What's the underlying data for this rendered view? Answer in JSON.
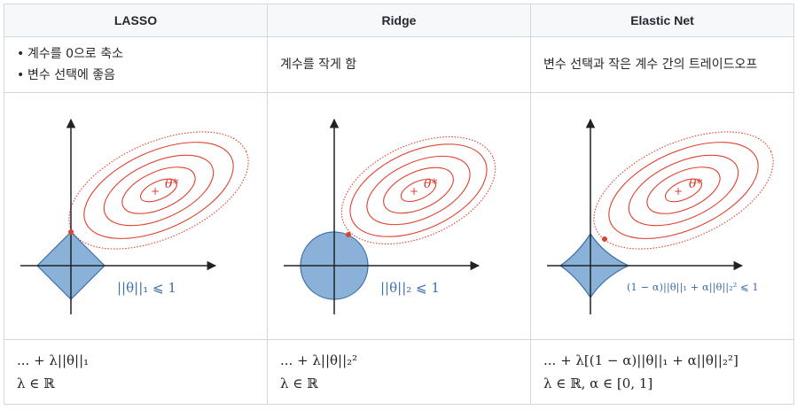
{
  "columns": [
    {
      "title": "LASSO",
      "description_bullets": [
        "계수를 0으로 축소",
        "변수 선택에 좋음"
      ],
      "plot": {
        "shape": "diamond",
        "theta_label": "θ*",
        "constraint_label": "||θ||₁ ⩽ 1"
      },
      "formula_line1": "... + λ||θ||₁",
      "formula_line2": "λ ∈ ℝ"
    },
    {
      "title": "Ridge",
      "description_text": "계수를 작게 함",
      "plot": {
        "shape": "circle",
        "theta_label": "θ*",
        "constraint_label": "||θ||₂ ⩽ 1"
      },
      "formula_line1": "... + λ||θ||₂²",
      "formula_line2": "λ ∈ ℝ"
    },
    {
      "title": "Elastic Net",
      "description_text": "변수 선택과 작은 계수 간의 트레이드오프",
      "plot": {
        "shape": "rounded-diamond",
        "theta_label": "θ*",
        "constraint_label": "(1 − α)||θ||₁ + α||θ||₂² ⩽ 1"
      },
      "formula_line1": "... + λ[(1 − α)||θ||₁ + α||θ||₂²]",
      "formula_line2": "λ ∈ ℝ, α ∈ [0, 1]"
    }
  ],
  "colors": {
    "region_fill": "#8ab2d9",
    "region_stroke": "#3f6ea8",
    "contour": "#e0402e",
    "axis": "#222222",
    "label_blue": "#3f6ea8",
    "border": "#d0d7de",
    "header_bg": "#f6f8fa"
  }
}
